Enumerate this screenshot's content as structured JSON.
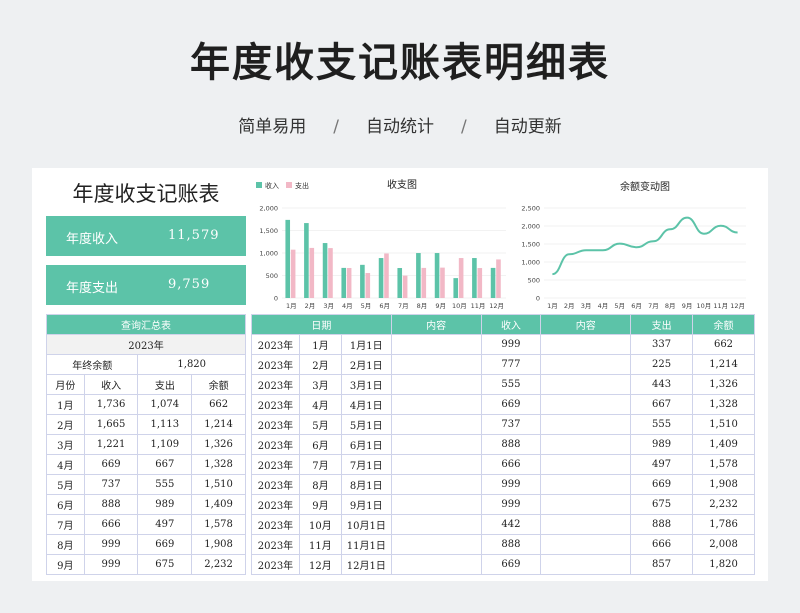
{
  "page": {
    "title": "年度收支记账表明细表",
    "features": [
      "简单易用",
      "自动统计",
      "自动更新"
    ],
    "separator": "/"
  },
  "sheet": {
    "panel_title": "年度收支记账表",
    "income": {
      "label": "年度收入",
      "value": "11,579"
    },
    "expense": {
      "label": "年度支出",
      "value": "9,759"
    }
  },
  "summary": {
    "header": "查询汇总表",
    "year": "2023年",
    "balance_label": "年终余额",
    "balance_value": "1,820",
    "columns": [
      "月份",
      "收入",
      "支出",
      "余额"
    ],
    "rows": [
      [
        "1月",
        "1,736",
        "1,074",
        "662"
      ],
      [
        "2月",
        "1,665",
        "1,113",
        "1,214"
      ],
      [
        "3月",
        "1,221",
        "1,109",
        "1,326"
      ],
      [
        "4月",
        "669",
        "667",
        "1,328"
      ],
      [
        "5月",
        "737",
        "555",
        "1,510"
      ],
      [
        "6月",
        "888",
        "989",
        "1,409"
      ],
      [
        "7月",
        "666",
        "497",
        "1,578"
      ],
      [
        "8月",
        "999",
        "669",
        "1,908"
      ],
      [
        "9月",
        "999",
        "675",
        "2,232"
      ]
    ]
  },
  "detail": {
    "columns": [
      "日期",
      "内容",
      "收入",
      "内容",
      "支出",
      "余额"
    ],
    "rows": [
      [
        "2023年",
        "1月",
        "1月1日",
        "",
        "999",
        "",
        "337",
        "662"
      ],
      [
        "2023年",
        "2月",
        "2月1日",
        "",
        "777",
        "",
        "225",
        "1,214"
      ],
      [
        "2023年",
        "3月",
        "3月1日",
        "",
        "555",
        "",
        "443",
        "1,326"
      ],
      [
        "2023年",
        "4月",
        "4月1日",
        "",
        "669",
        "",
        "667",
        "1,328"
      ],
      [
        "2023年",
        "5月",
        "5月1日",
        "",
        "737",
        "",
        "555",
        "1,510"
      ],
      [
        "2023年",
        "6月",
        "6月1日",
        "",
        "888",
        "",
        "989",
        "1,409"
      ],
      [
        "2023年",
        "7月",
        "7月1日",
        "",
        "666",
        "",
        "497",
        "1,578"
      ],
      [
        "2023年",
        "8月",
        "8月1日",
        "",
        "999",
        "",
        "669",
        "1,908"
      ],
      [
        "2023年",
        "9月",
        "9月1日",
        "",
        "999",
        "",
        "675",
        "2,232"
      ],
      [
        "2023年",
        "10月",
        "10月1日",
        "",
        "442",
        "",
        "888",
        "1,786"
      ],
      [
        "2023年",
        "11月",
        "11月1日",
        "",
        "888",
        "",
        "666",
        "2,008"
      ],
      [
        "2023年",
        "12月",
        "12月1日",
        "",
        "669",
        "",
        "857",
        "1,820"
      ]
    ]
  },
  "colors": {
    "accent": "#5cc3a8",
    "pink": "#f2b8c6",
    "grid": "#cfd3ea"
  },
  "chart_data": [
    {
      "type": "bar",
      "title": "收支图",
      "categories": [
        "1月",
        "2月",
        "3月",
        "4月",
        "5月",
        "6月",
        "7月",
        "8月",
        "9月",
        "10月",
        "11月",
        "12月"
      ],
      "series": [
        {
          "name": "收入",
          "values": [
            1736,
            1665,
            1221,
            669,
            737,
            888,
            666,
            999,
            999,
            442,
            888,
            669
          ],
          "color": "#5cc3a8"
        },
        {
          "name": "支出",
          "values": [
            1074,
            1113,
            1109,
            667,
            555,
            989,
            497,
            669,
            675,
            888,
            666,
            857
          ],
          "color": "#f2b8c6"
        }
      ],
      "yticks": [
        "0",
        "500",
        "1,000",
        "1,500",
        "2,000"
      ],
      "ylim": [
        0,
        2000
      ],
      "legend": "top-left"
    },
    {
      "type": "line",
      "title": "余额变动图",
      "categories": [
        "1月",
        "2月",
        "3月",
        "4月",
        "5月",
        "6月",
        "7月",
        "8月",
        "9月",
        "10月",
        "11月",
        "12月"
      ],
      "series": [
        {
          "values": [
            662,
            1214,
            1326,
            1328,
            1510,
            1409,
            1578,
            1908,
            2232,
            1786,
            2008,
            1820
          ],
          "color": "#5cc3a8"
        }
      ],
      "yticks": [
        "0",
        "500",
        "1,000",
        "1,500",
        "2,000",
        "2,500"
      ],
      "ylim": [
        0,
        2500
      ]
    }
  ]
}
